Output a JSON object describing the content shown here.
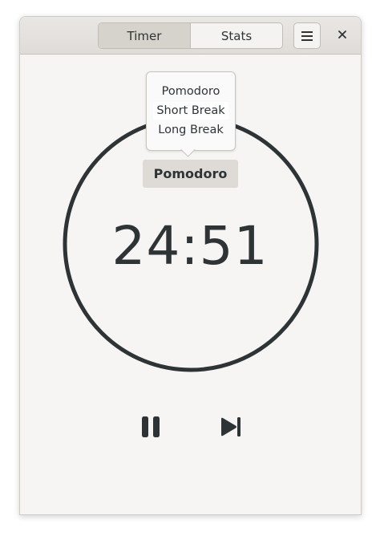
{
  "header": {
    "tabs": [
      {
        "label": "Timer",
        "active": true
      },
      {
        "label": "Stats",
        "active": false
      }
    ],
    "menu_icon": "hamburger-menu-icon",
    "close_icon": "close-icon"
  },
  "mode_popover": {
    "items": [
      {
        "label": "Pomodoro"
      },
      {
        "label": "Short Break",
        "highlighted": true
      },
      {
        "label": "Long Break"
      }
    ]
  },
  "timer": {
    "mode": "Pomodoro",
    "time": "24:51"
  },
  "controls": {
    "pause_icon": "pause-icon",
    "skip_icon": "skip-next-icon"
  },
  "colors": {
    "foreground": "#2e3436",
    "window_bg": "#f6f5f4",
    "headerbar": "#dfdcd8"
  }
}
